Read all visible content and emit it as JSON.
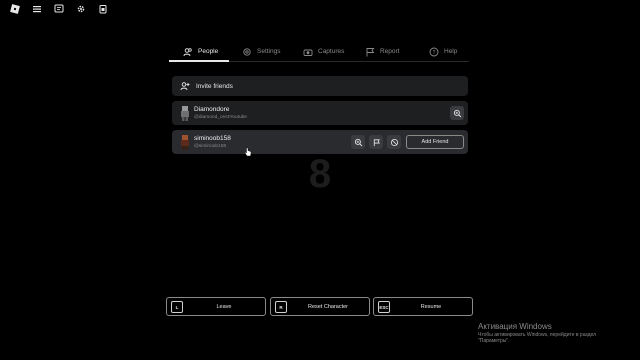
{
  "topbar": {
    "icons": [
      "roblox-logo-icon",
      "menu-icon",
      "chat-icon",
      "settings-gear-icon",
      "backpack-icon"
    ]
  },
  "tabs": [
    {
      "label": "People",
      "icon": "people-icon",
      "active": true
    },
    {
      "label": "Settings",
      "icon": "gear-icon",
      "active": false
    },
    {
      "label": "Captures",
      "icon": "camera-icon",
      "active": false
    },
    {
      "label": "Report",
      "icon": "flag-icon",
      "active": false
    },
    {
      "label": "Help",
      "icon": "help-icon",
      "active": false
    }
  ],
  "invite": {
    "label": "Invite friends",
    "icon": "add-person-icon"
  },
  "players": [
    {
      "name": "Diamondore",
      "handle": "@diamond_ore3Youtube",
      "actions": [
        "zoom-icon"
      ]
    },
    {
      "name": "siminoob158",
      "handle": "@siminoob158",
      "actions": [
        "zoom-icon",
        "flag-icon",
        "block-icon"
      ],
      "add_friend_label": "Add Friend"
    }
  ],
  "big_number": "8",
  "bottom_buttons": [
    {
      "key": "L",
      "label": "Leave"
    },
    {
      "key": "R",
      "label": "Reset Character"
    },
    {
      "key": "ESC",
      "label": "Resume"
    }
  ],
  "activation": {
    "title": "Активация Windows",
    "subtitle": "Чтобы активировать Windows, перейдите в раздел \"Параметры\"."
  },
  "colors": {
    "background": "#000000",
    "row": "#1e1f21",
    "row_hover": "#2a2b2e",
    "text": "#e8e8e8",
    "muted": "#8a8a8a"
  }
}
